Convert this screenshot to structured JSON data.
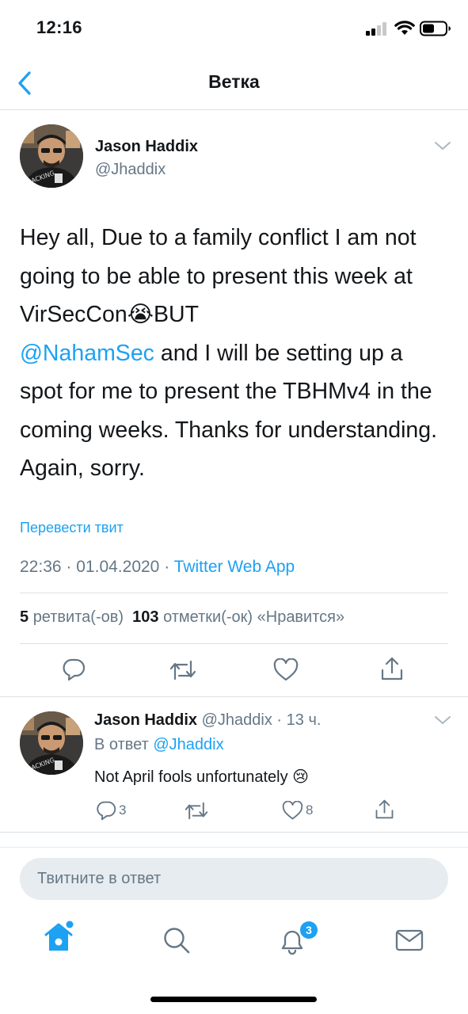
{
  "status_bar": {
    "time": "12:16"
  },
  "header": {
    "title": "Ветка"
  },
  "tweet": {
    "author_name": "Jason Haddix",
    "author_handle": "@Jhaddix",
    "text_part1": "Hey all, Due to a family conflict I am not going to be able to present this week at VirSecCon",
    "text_emoji": "😭",
    "text_part2": "BUT",
    "mention": "@NahamSec",
    "text_part3": " and I will be setting up a spot for me to present the TBHMv4 in the coming weeks. Thanks for understanding. Again, sorry.",
    "translate_label": "Перевести твит",
    "time": "22:36",
    "date": "01.04.2020",
    "sep": "·",
    "source": "Twitter Web App",
    "retweet_count": "5",
    "retweet_label": "ретвита(-ов)",
    "like_count": "103",
    "like_label": "отметки(-ок) «Нравится»"
  },
  "reply": {
    "author_name": "Jason Haddix",
    "author_handle": "@Jhaddix",
    "age": "· 13 ч.",
    "reply_to_label": "В ответ",
    "reply_to_handle": "@Jhaddix",
    "text": "Not April fools unfortunately",
    "text_emoji": "😢",
    "reply_count": "3",
    "like_count": "8"
  },
  "compose": {
    "placeholder": "Твитните в ответ"
  },
  "tab_bar": {
    "notifications_badge": "3"
  },
  "colors": {
    "accent": "#1da1f2",
    "muted": "#657786",
    "text": "#14171a",
    "divider": "#dbe1e6"
  },
  "icons": [
    "back-chevron-icon",
    "chevron-down-icon",
    "reply-icon",
    "retweet-icon",
    "like-icon",
    "share-icon",
    "home-icon",
    "search-icon",
    "notifications-icon",
    "messages-icon",
    "signal-icon",
    "wifi-icon",
    "battery-icon"
  ]
}
